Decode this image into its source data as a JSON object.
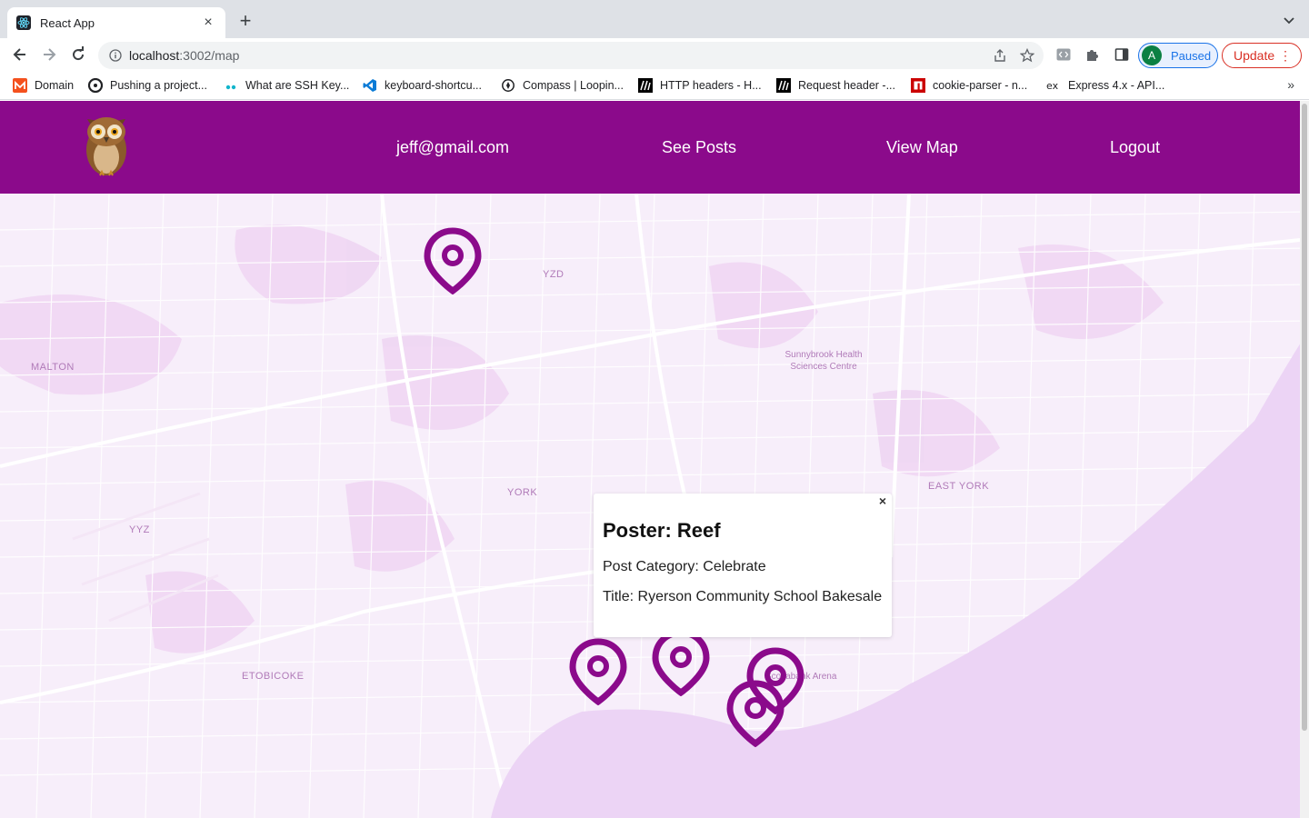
{
  "browser": {
    "tab_title": "React App",
    "url_host": "localhost",
    "url_path": ":3002/map",
    "profile_initial": "A",
    "profile_label": "Paused",
    "update_label": "Update"
  },
  "bookmarks": [
    {
      "label": "Domain",
      "icon": "domain-icon"
    },
    {
      "label": "Pushing a project...",
      "icon": "github-icon"
    },
    {
      "label": "What are SSH Key...",
      "icon": "ssh-icon"
    },
    {
      "label": "keyboard-shortcu...",
      "icon": "vscode-icon"
    },
    {
      "label": "Compass | Loopin...",
      "icon": "compass-icon"
    },
    {
      "label": "HTTP headers - H...",
      "icon": "mdn-icon"
    },
    {
      "label": "Request header -...",
      "icon": "mdn-icon"
    },
    {
      "label": "cookie-parser - n...",
      "icon": "npm-icon"
    },
    {
      "label": "Express 4.x - API...",
      "icon": "express-icon"
    }
  ],
  "nav": {
    "user_email": "jeff@gmail.com",
    "see_posts": "See Posts",
    "view_map": "View Map",
    "logout": "Logout"
  },
  "map": {
    "labels": {
      "yzd": "YZD",
      "malton": "MALTON",
      "sunnybrook": "Sunnybrook Health Sciences Centre",
      "york": "YORK",
      "east_york": "EAST YORK",
      "yyz": "YYZ",
      "etobicoke": "ETOBICOKE",
      "arena": "Scotiabank Arena"
    },
    "marker_color": "#8b0a8b"
  },
  "popup": {
    "close": "×",
    "poster": "Poster: Reef",
    "category": "Post Category: Celebrate",
    "title": "Title: Ryerson Community School Bakesale"
  }
}
